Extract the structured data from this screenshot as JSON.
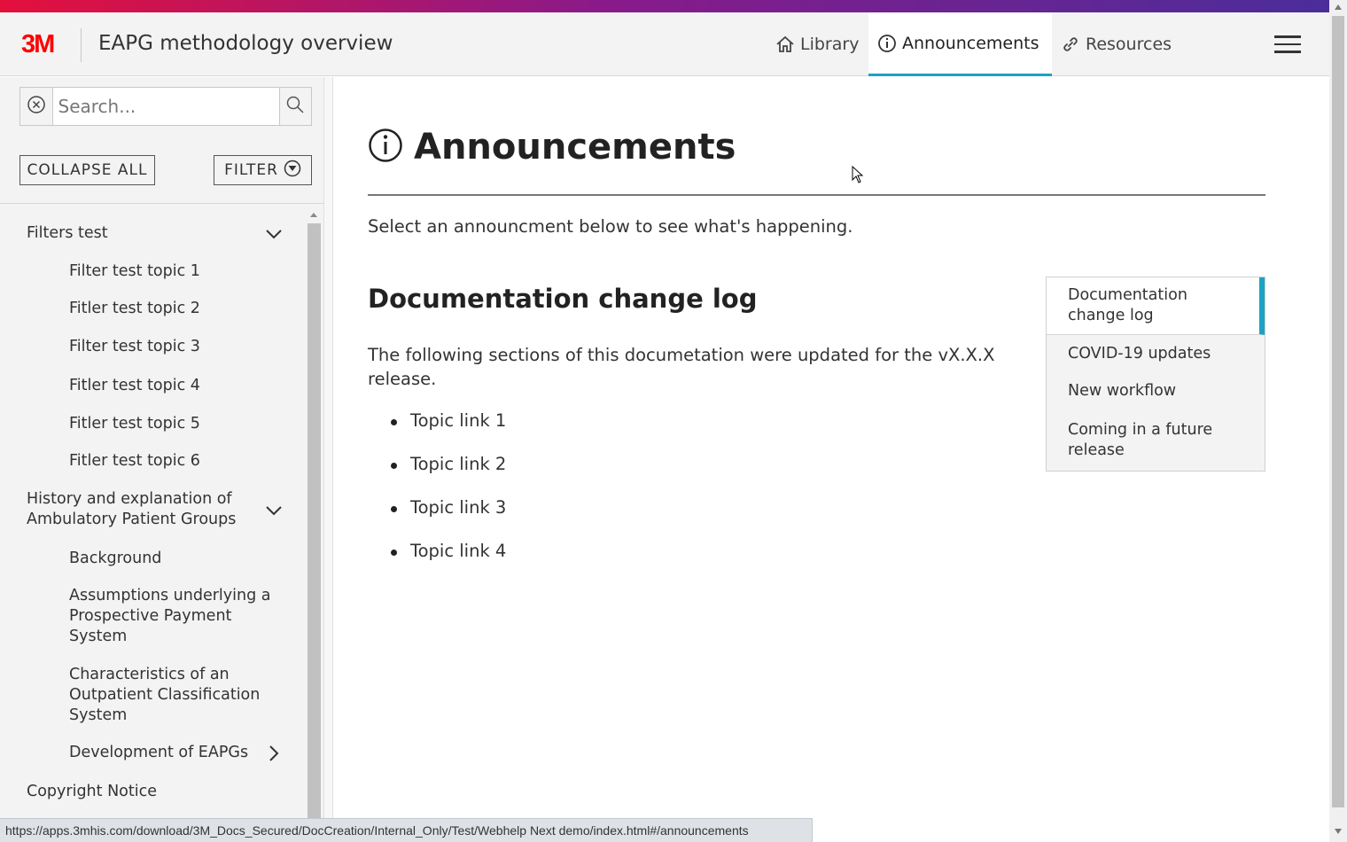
{
  "header": {
    "logo_text": "3M",
    "site_title": "EAPG methodology overview",
    "nav": [
      {
        "label": "Library",
        "icon": "home-icon"
      },
      {
        "label": "Announcements",
        "icon": "info-icon",
        "active": true
      },
      {
        "label": "Resources",
        "icon": "link-icon"
      }
    ],
    "menu_icon": "hamburger-menu-icon"
  },
  "sidebar": {
    "search": {
      "placeholder": "Search...",
      "value": ""
    },
    "collapse_all_label": "COLLAPSE ALL",
    "filter_label": "FILTER",
    "toc": [
      {
        "label": "Filters test",
        "level": 0,
        "expanded": true
      },
      {
        "label": "Filter test topic 1",
        "level": 1
      },
      {
        "label": "Fitler test topic 2",
        "level": 1
      },
      {
        "label": "Filter test topic 3",
        "level": 1
      },
      {
        "label": "Fitler test topic 4",
        "level": 1
      },
      {
        "label": "Fitler test topic 5",
        "level": 1
      },
      {
        "label": "Fitler test topic 6",
        "level": 1
      },
      {
        "label": "History and explanation of Ambulatory Patient Groups",
        "level": 0,
        "expanded": true
      },
      {
        "label": "Background",
        "level": 1
      },
      {
        "label": "Assumptions underlying a Prospective Payment System",
        "level": 1
      },
      {
        "label": "Characteristics of an Outpatient Classification System",
        "level": 1
      },
      {
        "label": "Development of EAPGs",
        "level": 1,
        "expanded": false
      },
      {
        "label": "Copyright Notice",
        "level": 0
      }
    ]
  },
  "main": {
    "title": "Announcements",
    "intro": "Select an announcment below to see what's happening.",
    "section_title": "Documentation change log",
    "section_desc": "The following sections of this documetation were updated for the vX.X.X release.",
    "topic_links": [
      "Topic link 1",
      "Topic link 2",
      "Topic link 3",
      "Topic link 4"
    ],
    "mini_toc": [
      {
        "label": "Documentation change log",
        "active": true
      },
      {
        "label": "COVID-19 updates"
      },
      {
        "label": "New workflow"
      },
      {
        "label": "Coming in a future release"
      }
    ]
  },
  "status_bar": {
    "url": "https://apps.3mhis.com/download/3M_Docs_Secured/DocCreation/Internal_Only/Test/Webhelp Next demo/index.html#/announcements"
  },
  "colors": {
    "brand": "#ff0000",
    "accent": "#1ca2c4",
    "gradient_start": "#e4103c",
    "gradient_end": "#4b2d9a"
  }
}
